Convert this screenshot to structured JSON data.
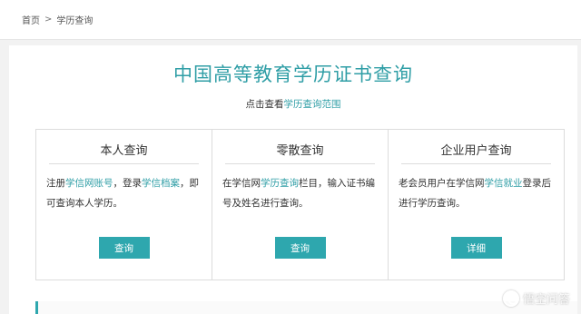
{
  "breadcrumb": {
    "home": "首页",
    "separator": ">",
    "current": "学历查询"
  },
  "header": {
    "title": "中国高等教育学历证书查询",
    "sub_prefix": "点击查看",
    "sub_link": "学历查询范围"
  },
  "cards": [
    {
      "title": "本人查询",
      "desc": [
        {
          "t": "注册",
          "link": false
        },
        {
          "t": "学信网账号",
          "link": true
        },
        {
          "t": "，登录",
          "link": false
        },
        {
          "t": "学信档案",
          "link": true
        },
        {
          "t": "，即可查询本人学历。",
          "link": false
        }
      ],
      "button": "查询"
    },
    {
      "title": "零散查询",
      "desc": [
        {
          "t": "在学信网",
          "link": false
        },
        {
          "t": "学历查询",
          "link": true
        },
        {
          "t": "栏目，输入证书编号及姓名进行查询。",
          "link": false
        }
      ],
      "button": "查询"
    },
    {
      "title": "企业用户查询",
      "desc": [
        {
          "t": "老会员用户在学信网",
          "link": false
        },
        {
          "t": "学信就业",
          "link": true
        },
        {
          "t": "登录后进行学历查询。",
          "link": false
        }
      ],
      "button": "详细"
    }
  ],
  "watermark": {
    "text": "悟空问答"
  },
  "colors": {
    "accent": "#2f9ea6",
    "button": "#2ea7ae",
    "background": "#f2f2f2"
  }
}
